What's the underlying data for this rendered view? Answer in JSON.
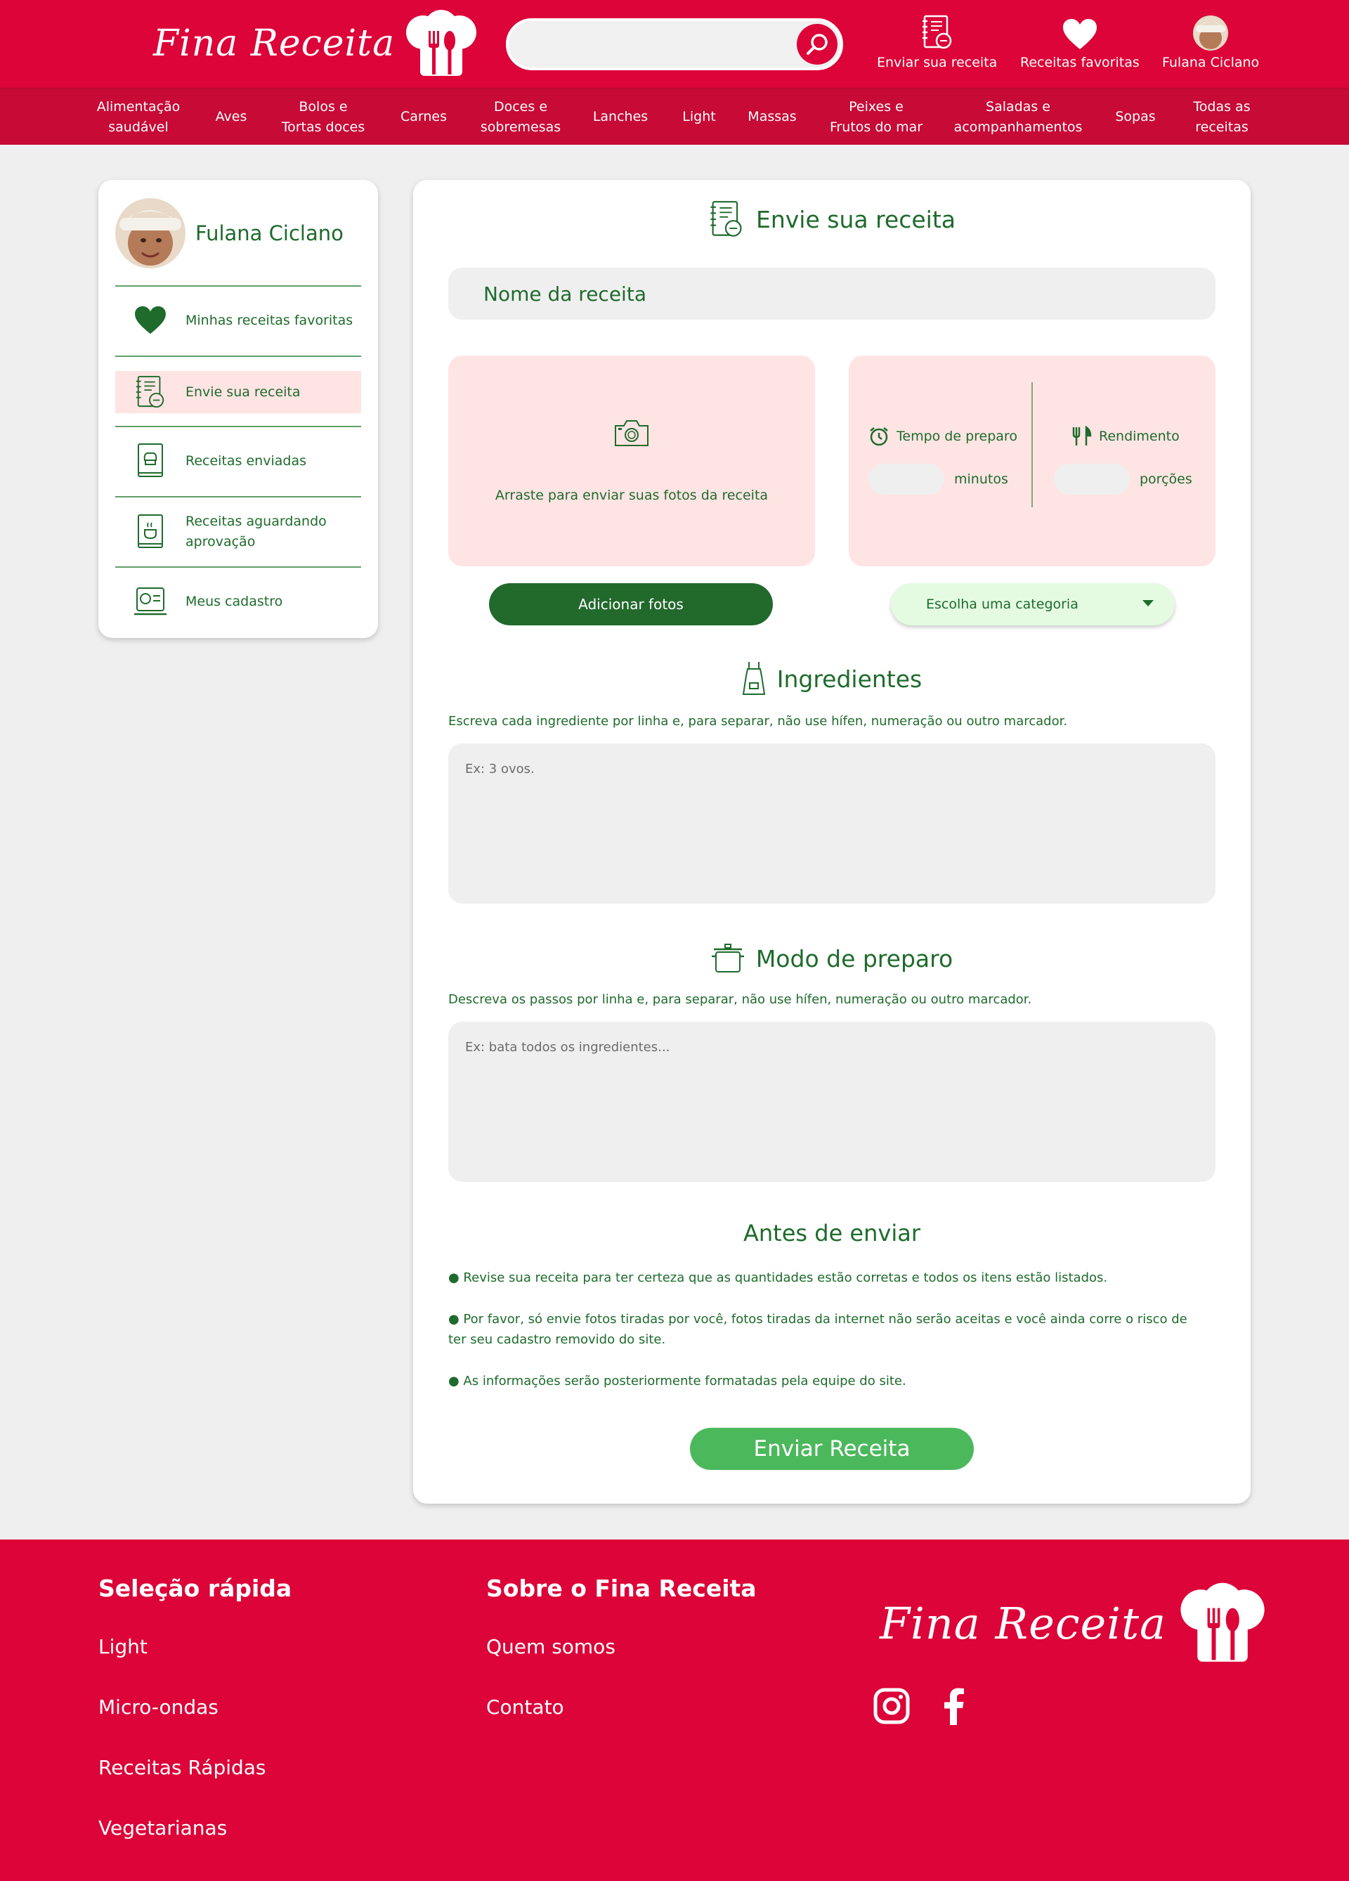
{
  "header": {
    "logo_text": "Fina Receita",
    "search": {
      "value": "",
      "icon": "search-icon"
    },
    "actions": [
      {
        "label": "Enviar sua receita",
        "icon": "recipe-notebook-icon"
      },
      {
        "label": "Receitas favoritas",
        "icon": "heart-icon"
      },
      {
        "label": "Fulana Ciclano",
        "icon": "avatar"
      }
    ]
  },
  "categories": [
    "Alimentação\nsaudável",
    "Aves",
    "Bolos e\nTortas doces",
    "Carnes",
    "Doces e\nsobremesas",
    "Lanches",
    "Light",
    "Massas",
    "Peixes e\nFrutos do mar",
    "Saladas e\nacompanhamentos",
    "Sopas",
    "Todas as\nreceitas"
  ],
  "sidebar": {
    "user_name": "Fulana Ciclano",
    "items": [
      {
        "label": "Minhas receitas favoritas",
        "icon": "heart-icon",
        "active": false
      },
      {
        "label": "Envie sua receita",
        "icon": "recipe-notebook-icon",
        "active": true
      },
      {
        "label": "Receitas enviadas",
        "icon": "cookbook-icon",
        "active": false
      },
      {
        "label": "Receitas aguardando\naprovação",
        "icon": "pending-book-icon",
        "active": false
      },
      {
        "label": "Meus cadastro",
        "icon": "profile-card-icon",
        "active": false
      }
    ]
  },
  "form": {
    "title": "Envie sua receita",
    "name_placeholder": "Nome da receita",
    "upload_text": "Arraste para enviar suas fotos da receita",
    "prep_time": {
      "label": "Tempo de preparo",
      "value": "",
      "unit": "minutos"
    },
    "yield": {
      "label": "Rendimento",
      "value": "",
      "unit": "porções"
    },
    "add_photos_label": "Adicionar fotos",
    "category_select": "Escolha uma categoria",
    "ingredients": {
      "title": "Ingredientes",
      "hint": "Escreva cada ingrediente por linha e, para separar, não use hífen, numeração ou outro marcador.",
      "placeholder": "Ex: 3 ovos."
    },
    "preparation": {
      "title": "Modo de preparo",
      "hint": "Descreva os passos por linha e, para separar, não use hífen, numeração ou outro marcador.",
      "placeholder": "Ex: bata todos os ingredientes..."
    },
    "before_sending": {
      "title": "Antes de enviar",
      "bullets": [
        "● Revise sua receita para ter certeza que as quantidades estão corretas e todos os itens estão listados.",
        "● Por favor, só envie fotos tiradas por você, fotos tiradas da internet não serão aceitas e você ainda corre o risco de ter seu cadastro removido do site.",
        "● As informações serão posteriormente formatadas pela equipe do site."
      ]
    },
    "submit_label": "Enviar Receita"
  },
  "footer": {
    "quick_title": "Seleção rápida",
    "quick_links": [
      "Light",
      "Micro-ondas",
      "Receitas Rápidas",
      "Vegetarianas"
    ],
    "about_title": "Sobre o Fina Receita",
    "about_links": [
      "Quem somos",
      "Contato"
    ],
    "logo_text": "Fina Receita",
    "social": [
      "instagram-icon",
      "facebook-icon"
    ]
  },
  "colors": {
    "brand_red": "#dc0438",
    "category_bar": "#c70a36",
    "green_text": "#1e6b2c",
    "green_button": "#22692c",
    "submit_green": "#4cb85c",
    "pink_panel": "#ffe4e4",
    "mint_select": "#e4fbe2",
    "background": "#efefef"
  }
}
